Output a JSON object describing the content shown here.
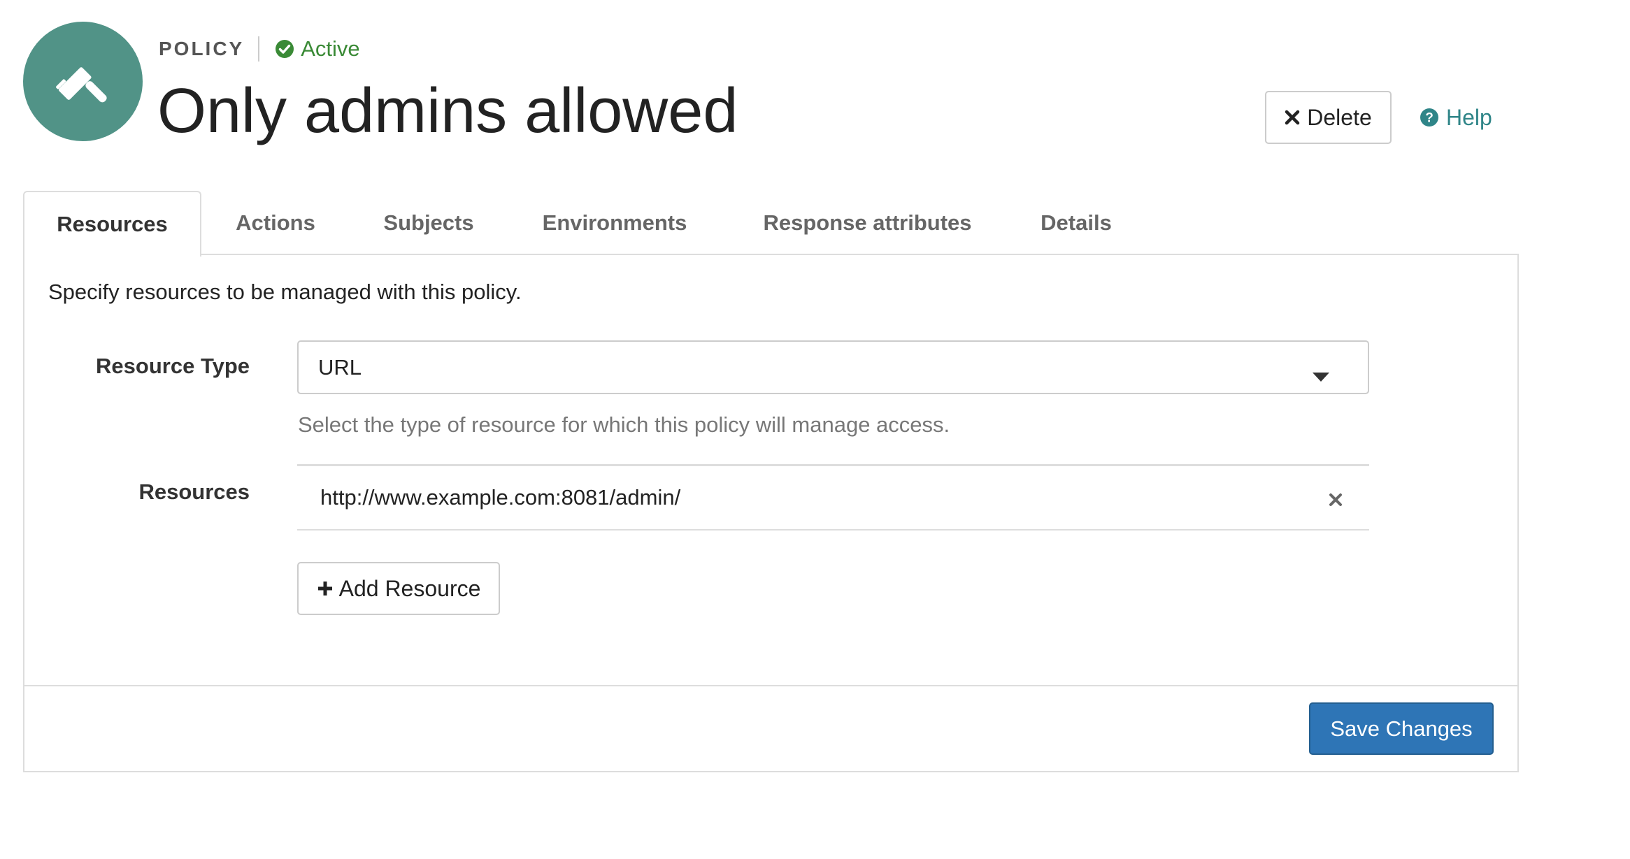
{
  "header": {
    "kicker": "POLICY",
    "status": "Active",
    "title": "Only admins allowed",
    "icon": "gavel-icon",
    "avatar_color": "#519387"
  },
  "actions": {
    "delete_label": "Delete",
    "help_label": "Help"
  },
  "tabs": [
    {
      "label": "Resources",
      "active": true
    },
    {
      "label": "Actions",
      "active": false
    },
    {
      "label": "Subjects",
      "active": false
    },
    {
      "label": "Environments",
      "active": false
    },
    {
      "label": "Response attributes",
      "active": false
    },
    {
      "label": "Details",
      "active": false
    }
  ],
  "resources_tab": {
    "intro": "Specify resources to be managed with this policy.",
    "resource_type": {
      "label": "Resource Type",
      "value": "URL",
      "help": "Select the type of resource for which this policy will manage access."
    },
    "resources": {
      "label": "Resources",
      "items": [
        "http://www.example.com:8081/admin/"
      ],
      "add_label": "Add Resource"
    }
  },
  "footer": {
    "save_label": "Save Changes"
  },
  "colors": {
    "accent": "#2e75b6",
    "status": "#3a8a36",
    "link": "#2f8588"
  }
}
